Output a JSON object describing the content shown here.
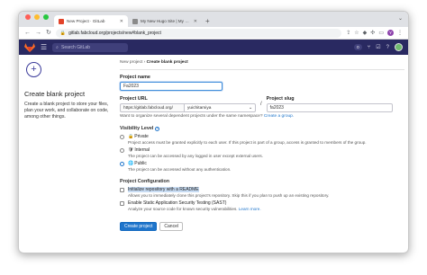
{
  "browser": {
    "tabs": [
      {
        "title": "New Project · GitLab",
        "active": true
      },
      {
        "title": "My New Hugo Site | My New",
        "active": false
      }
    ],
    "new_tab": "+",
    "url": "gitlab.fabcloud.org/projects/new#blank_project",
    "profile_initial": "Y"
  },
  "gitlab": {
    "search_placeholder": "Search GitLab",
    "badge_count": "0"
  },
  "left": {
    "title": "Create blank project",
    "description": "Create a blank project to store your files, plan your work, and collaborate on code, among other things."
  },
  "breadcrumb": {
    "parent": "New project",
    "separator": "›",
    "current": "Create blank project"
  },
  "form": {
    "project_name_label": "Project name",
    "project_name_value": "Fa2023",
    "project_url_label": "Project URL",
    "project_url_prefix": "https://gitlab.fabcloud.org/",
    "namespace_value": "yuichitamiya",
    "slash": "/",
    "slug_label": "Project slug",
    "slug_value": "fa2023",
    "group_hint": "Want to organize several dependent projects under the same namespace?",
    "group_link": "Create a group.",
    "visibility_label": "Visibility Level",
    "visibility_options": [
      {
        "title": "Private",
        "desc": "Project access must be granted explicitly to each user. If this project is part of a group, access is granted to members of the group.",
        "selected": false,
        "glyph": "🔒"
      },
      {
        "title": "Internal",
        "desc": "The project can be accessed by any logged in user except external users.",
        "selected": false,
        "glyph": "🛡"
      },
      {
        "title": "Public",
        "desc": "The project can be accessed without any authentication.",
        "selected": true,
        "glyph": "🌐"
      }
    ],
    "config_label": "Project Configuration",
    "config_options": [
      {
        "title": "Initialize repository with a README",
        "desc": "Allows you to immediately clone this project's repository. Skip this if you plan to push up an existing repository.",
        "checked": false
      },
      {
        "title": "Enable Static Application Security Testing (SAST)",
        "desc": "Analyze your source code for known security vulnerabilities.",
        "link": "Learn more.",
        "checked": false
      }
    ],
    "create_button": "Create project",
    "cancel_button": "Cancel"
  }
}
